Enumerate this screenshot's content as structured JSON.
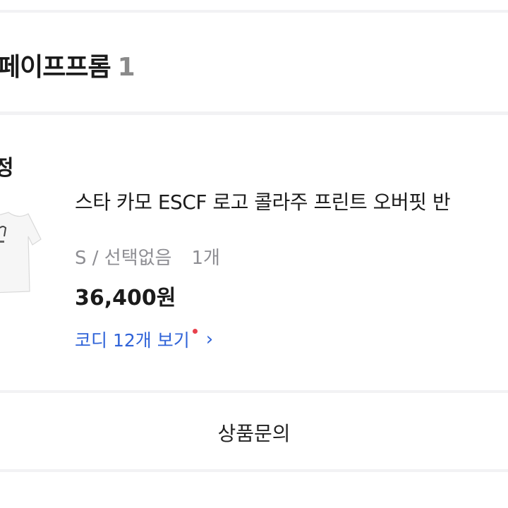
{
  "store": {
    "name": "페이프프롬",
    "count": "1"
  },
  "order": {
    "status": "정",
    "product": {
      "name": "스타 카모 ESCF 로고 콜라주 프린트 오버핏 반",
      "option": "S / 선택없음",
      "quantity": "1개",
      "price": "36,400원",
      "thumbnail_icon": "white-tshirt-image"
    },
    "coordi_link": {
      "label": "코디 12개 보기",
      "chevron": "›",
      "badge_color": "#e8414d"
    }
  },
  "inquiry": {
    "label": "상품문의"
  },
  "colors": {
    "accent_link": "#2f63d8",
    "background": "#f2f2f4"
  }
}
